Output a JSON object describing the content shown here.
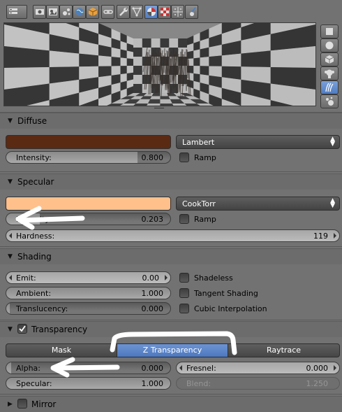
{
  "header": {
    "editor_type_icon": "properties-editor-icon",
    "context_tabs": [
      {
        "icon": "render-icon"
      },
      {
        "icon": "scene-icon"
      },
      {
        "icon": "world-icon"
      },
      {
        "icon": "object-icon"
      },
      {
        "icon": "constraints-icon"
      },
      {
        "icon": "modifiers-icon"
      },
      {
        "icon": "object-data-icon"
      },
      {
        "icon": "material-icon",
        "active": true
      },
      {
        "icon": "texture-icon"
      },
      {
        "icon": "particles-icon"
      },
      {
        "icon": "physics-icon"
      }
    ]
  },
  "preview": {
    "type_buttons": [
      {
        "icon": "flat-preview-icon"
      },
      {
        "icon": "sphere-preview-icon"
      },
      {
        "icon": "cube-preview-icon"
      },
      {
        "icon": "monkey-preview-icon"
      },
      {
        "icon": "hair-preview-icon",
        "active": true
      },
      {
        "icon": "sphere-sky-preview-icon"
      }
    ]
  },
  "diffuse": {
    "title": "Diffuse",
    "color": "#5b2a12",
    "shader": "Lambert",
    "intensity": {
      "label": "Intensity:",
      "value": "0.800",
      "fraction": 0.8
    },
    "ramp": {
      "label": "Ramp",
      "checked": false
    }
  },
  "specular": {
    "title": "Specular",
    "color": "#ffc08c",
    "shader": "CookTorr",
    "intensity": {
      "label": "Intensity:",
      "value": "0.203",
      "fraction": 0.203
    },
    "ramp": {
      "label": "Ramp",
      "checked": false
    },
    "hardness": {
      "label": "Hardness:",
      "value": "119"
    }
  },
  "shading": {
    "title": "Shading",
    "emit": {
      "label": "Emit:",
      "value": "0.00"
    },
    "ambient": {
      "label": "Ambient:",
      "value": "1.000",
      "fraction": 1.0
    },
    "translucency": {
      "label": "Translucency:",
      "value": "0.000",
      "fraction": 0.0
    },
    "shadeless": {
      "label": "Shadeless",
      "checked": false
    },
    "tangent": {
      "label": "Tangent Shading",
      "checked": false
    },
    "cubic": {
      "label": "Cubic Interpolation",
      "checked": false
    }
  },
  "transparency": {
    "title": "Transparency",
    "enabled": true,
    "modes": [
      "Mask",
      "Z Transparency",
      "Raytrace"
    ],
    "active_mode": "Z Transparency",
    "alpha": {
      "label": "Alpha:",
      "value": "0.000"
    },
    "fresnel": {
      "label": "Fresnel:",
      "value": "0.000"
    },
    "specular": {
      "label": "Specular:",
      "value": "1.000",
      "fraction": 1.0
    },
    "blend": {
      "label": "Blend:",
      "value": "1.250"
    }
  },
  "mirror": {
    "title": "Mirror",
    "enabled": false
  },
  "colors": {
    "accent": "#5680c2",
    "background": "#727272",
    "annotation": "#ffffff"
  }
}
